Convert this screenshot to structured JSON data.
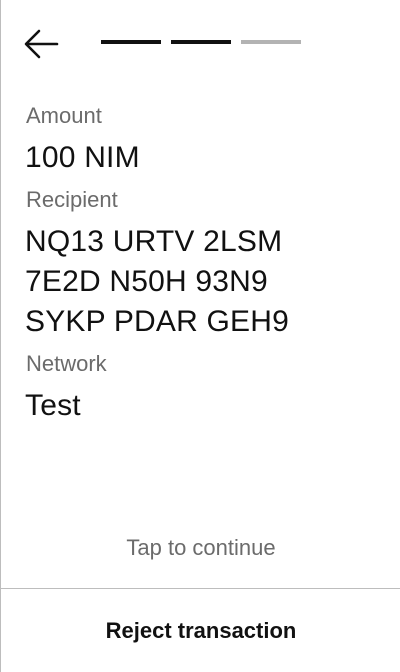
{
  "header": {
    "back_icon": "arrow-left-icon",
    "progress": {
      "total_steps": 3,
      "completed_steps": 2
    },
    "colors": {
      "step_done": "#111111",
      "step_pending": "#b3b3b3"
    }
  },
  "details": {
    "amount_label": "Amount",
    "amount_value": "100 NIM",
    "recipient_label": "Recipient",
    "recipient_lines": [
      "NQ13 URTV 2LSM",
      "7E2D N50H 93N9",
      "SYKP PDAR GEH9"
    ],
    "network_label": "Network",
    "network_value": "Test"
  },
  "footer": {
    "tap_hint": "Tap to continue",
    "reject_label": "Reject transaction"
  }
}
